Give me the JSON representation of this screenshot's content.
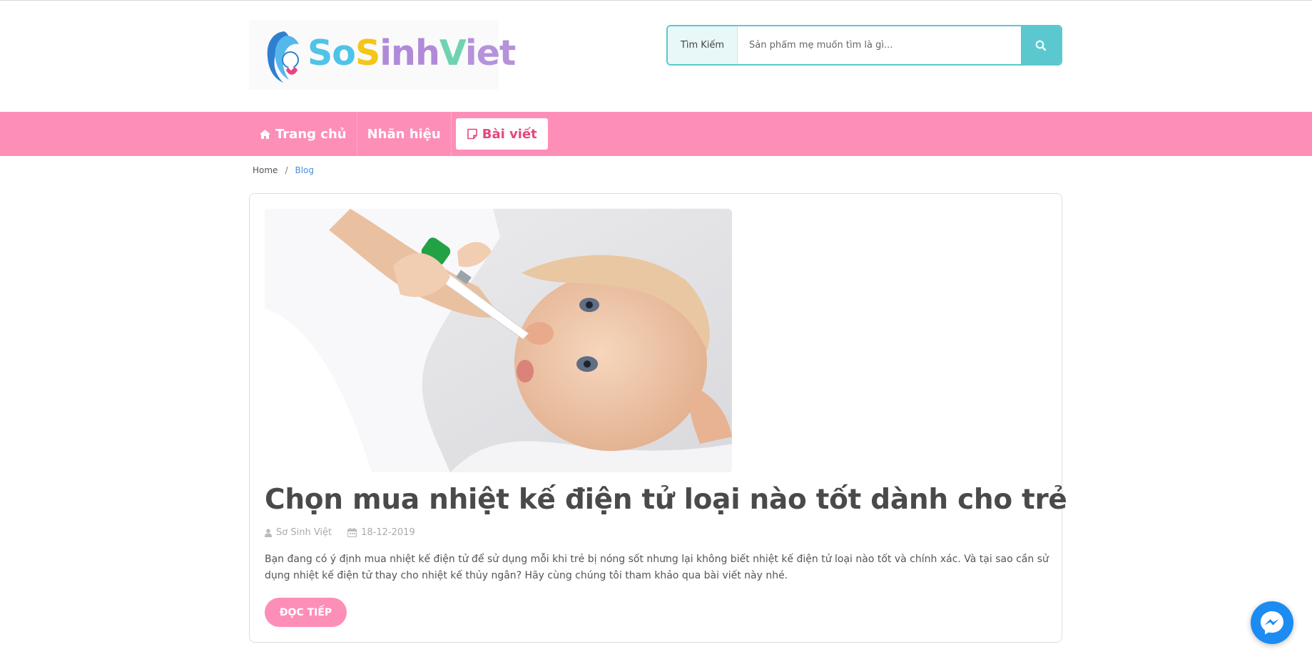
{
  "logo": {
    "alt": "SoSinhViet",
    "parts": [
      "So",
      "S",
      "inh",
      "V",
      "iet"
    ]
  },
  "search": {
    "label": "Tìm Kiếm",
    "placeholder": "Sản phẩm mẹ muốn tìm là gì...",
    "icon": "search-icon"
  },
  "nav": {
    "items": [
      {
        "label": "Trang chủ",
        "icon": "home-icon"
      },
      {
        "label": "Nhãn hiệu"
      },
      {
        "label": "Bài viết",
        "icon": "note-icon",
        "active": true
      }
    ]
  },
  "breadcrumb": {
    "home": "Home",
    "separator": "/",
    "current": "Blog"
  },
  "post": {
    "image_alt": "baby-with-thermometer",
    "title": "Chọn mua nhiệt kế điện tử loại nào tốt dành cho trẻ",
    "author": "Sơ Sinh Việt",
    "date": "18-12-2019",
    "excerpt": "Bạn đang có ý định mua nhiệt kế điện tử để sử dụng mỗi khi trẻ bị nóng sốt nhưng lại không biết nhiệt kế điện tử loại nào tốt và chính xác. Và tại sao cần sử dụng nhiệt kế điện tử thay cho nhiệt kế thủy ngân? Hãy cùng chúng tôi tham khảo qua bài viết này nhé.",
    "read_more": "ĐỌC TIẾP"
  },
  "colors": {
    "brand_pink": "#fd8eb8",
    "search_teal": "#5bc8cf",
    "active_text": "#e8457f",
    "messenger_blue": "#1c8cf2"
  }
}
